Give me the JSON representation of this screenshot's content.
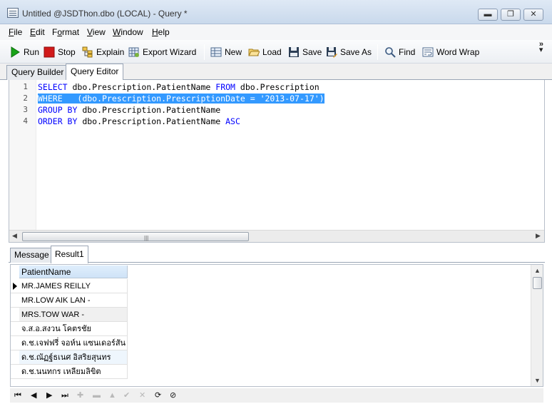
{
  "window": {
    "title": "Untitled @JSDThon.dbo (LOCAL) - Query *",
    "buttons": {
      "minimize": "▬",
      "maximize": "❐",
      "close": "✕"
    }
  },
  "menu": {
    "items": [
      {
        "first": "F",
        "rest": "ile"
      },
      {
        "first": "E",
        "rest": "dit"
      },
      {
        "pre": "F",
        "u": "o",
        "post": "rmat"
      },
      {
        "first": "V",
        "rest": "iew"
      },
      {
        "first": "W",
        "rest": "indow"
      },
      {
        "first": "H",
        "rest": "elp"
      }
    ]
  },
  "toolbar": {
    "run": "Run",
    "stop": "Stop",
    "explain": "Explain",
    "export_wizard": "Export Wizard",
    "new": "New",
    "load": "Load",
    "save": "Save",
    "save_as": "Save As",
    "find": "Find",
    "word_wrap": "Word Wrap",
    "overflow": "»"
  },
  "query_tabs": [
    "Query Builder",
    "Query Editor"
  ],
  "editor": {
    "line_numbers": [
      "1",
      "2",
      "3",
      "4"
    ],
    "lines": [
      {
        "kw1": "SELECT",
        "t1": " dbo.Prescription.PatientName ",
        "kw2": "FROM",
        "t2": " dbo.Prescription"
      },
      {
        "kw1": "WHERE",
        "t1": "   (dbo.Prescription.PrescriptionDate = ",
        "str": "'2013-07-17'",
        "t2": ")"
      },
      {
        "kw1": "GROUP BY",
        "t1": " dbo.Prescription.PatientName"
      },
      {
        "kw1": "ORDER BY",
        "t1": " dbo.Prescription.PatientName ",
        "kw2": "ASC"
      }
    ],
    "selected_line": 2,
    "hscroll_grip": "|||"
  },
  "result_tabs": [
    "Message",
    "Result1"
  ],
  "result": {
    "column": "PatientName",
    "current_row": 0,
    "rows": [
      "MR.JAMES REILLY",
      "MR.LOW AIK LAN -",
      "MRS.TOW WAR -",
      " จ.ส.อ.สงวน โคตรชัย",
      "ด.ช.เจฟฟรี่ จอห์น แซนเดอร์สัน",
      "ด.ช.ณัฏฐ์ธเนศ อิสริยสุนทร",
      "ด.ช.นนทกร เหลียมลิขิต"
    ]
  },
  "navigator": [
    "⏮",
    "◀",
    "▶",
    "⏭",
    "✚",
    "▬",
    "▲",
    "✔",
    "✕",
    "⟳",
    "⊘"
  ],
  "colors": {
    "keyword": "#0000ff",
    "string": "#a31515",
    "selection": "#3399ff",
    "run_icon": "#17a317",
    "stop_icon": "#d11a1a"
  }
}
